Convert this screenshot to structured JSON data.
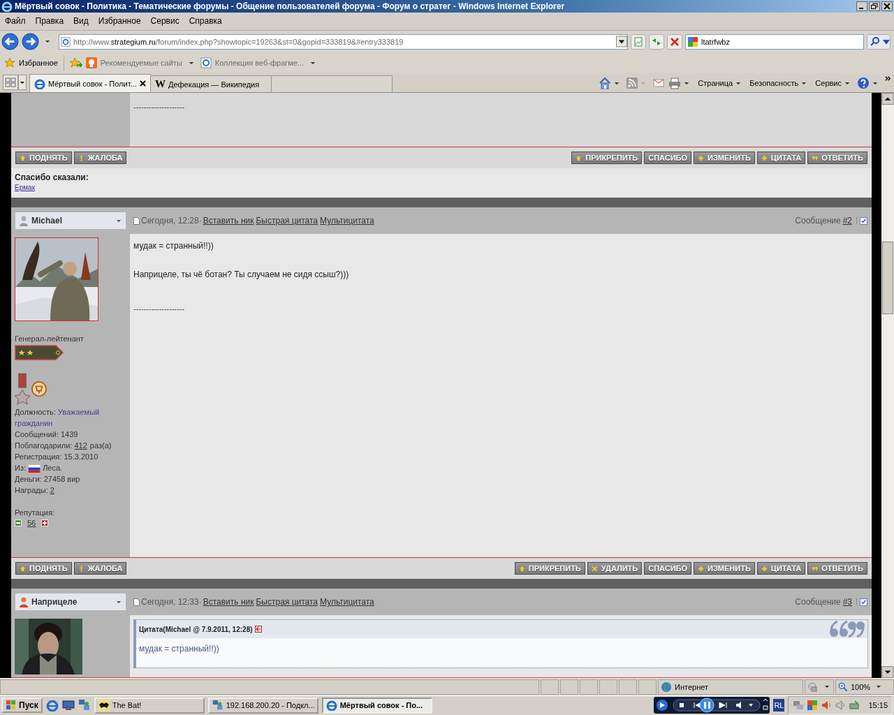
{
  "window": {
    "title": "Мёртвый совок - Политика - Тематические форумы - Общение пользователей форума - Форум о стратег - Windows Internet Explorer"
  },
  "menu": [
    "Файл",
    "Правка",
    "Вид",
    "Избранное",
    "Сервис",
    "Справка"
  ],
  "address": {
    "prefix": "http://www.",
    "domain": "strategium.ru",
    "path": "/forum/index.php?showtopic=19263&st=0&gopid=333819&#entry333819",
    "search": "ltatrfwbz"
  },
  "favorites": {
    "label": "Избранное",
    "items": [
      "Рекомендуемые сайты",
      "Коллекция веб-фрагме..."
    ]
  },
  "tabs": [
    {
      "label": "Мёртвый совок - Полит...",
      "selected": true,
      "kind": "ie"
    },
    {
      "label": "Дефекация — Википедия",
      "selected": false,
      "kind": "wiki",
      "icon_letter": "W"
    }
  ],
  "command_bar": [
    "Страница",
    "Безопасность",
    "Сервис"
  ],
  "posts": [
    {
      "signature": "--------------------",
      "left_buttons": [
        {
          "label": "ПОДНЯТЬ",
          "kind": "up"
        },
        {
          "label": "ЖАЛОБА",
          "kind": "warn"
        }
      ],
      "right_buttons": [
        {
          "label": "ПРИКРЕПИТЬ",
          "kind": "up"
        },
        {
          "label": "СПАСИБО",
          "kind": "plain"
        },
        {
          "label": "ИЗМЕНИТЬ",
          "kind": "plus"
        },
        {
          "label": "ЦИТАТА",
          "kind": "plus"
        },
        {
          "label": "ОТВЕТИТЬ",
          "kind": "quote"
        }
      ],
      "thanks": {
        "title": "Спасибо сказали:",
        "names": [
          "Ермак"
        ]
      }
    },
    {
      "author": "Michael",
      "online": false,
      "date": "Сегодня, 12:28·",
      "actions": [
        "Вставить ник",
        "Быстрая цитата",
        "Мультицитата"
      ],
      "number_label": "Сообщение",
      "number": "#2",
      "checked": true,
      "profile": {
        "rank": "Генерал-лейтенант",
        "fields": [
          {
            "kind": "role",
            "label": "Должность:",
            "value": "Уважаемый гражданин"
          },
          {
            "kind": "text",
            "label": "Сообщений:",
            "value": "1439"
          },
          {
            "kind": "link",
            "label": "Поблагодарили:",
            "value": "412",
            "suffix": "раз(а)"
          },
          {
            "kind": "text",
            "label": "Регистрация:",
            "value": "15.3.2010"
          },
          {
            "kind": "flag",
            "label": "Из:",
            "value": "Леса."
          },
          {
            "kind": "text",
            "label": "Деньги:",
            "value": "27458 вир"
          },
          {
            "kind": "link",
            "label": "Награды:",
            "value": "2"
          }
        ],
        "reputation_label": "Репутация:",
        "reputation": "56"
      },
      "paragraphs": [
        "мудак = странный!!))",
        "Наприцеле, ты чё ботан? Ты случаем не сидя ссыш?)))"
      ],
      "signature": "--------------------",
      "left_buttons": [
        {
          "label": "ПОДНЯТЬ",
          "kind": "up"
        },
        {
          "label": "ЖАЛОБА",
          "kind": "warn"
        }
      ],
      "right_buttons": [
        {
          "label": "ПРИКРЕПИТЬ",
          "kind": "up"
        },
        {
          "label": "УДАЛИТЬ",
          "kind": "cross"
        },
        {
          "label": "СПАСИБО",
          "kind": "plain"
        },
        {
          "label": "ИЗМЕНИТЬ",
          "kind": "plus"
        },
        {
          "label": "ЦИТАТА",
          "kind": "plus"
        },
        {
          "label": "ОТВЕТИТЬ",
          "kind": "quote"
        }
      ]
    },
    {
      "author": "Наприцеле",
      "online": true,
      "date": "Сегодня, 12:33·",
      "actions": [
        "Вставить ник",
        "Быстрая цитата",
        "Мультицитата"
      ],
      "number_label": "Сообщение",
      "number": "#3",
      "checked": true,
      "quote": {
        "header": "Цитата(Michael @ 7.9.2011, 12:28)",
        "text": "мудак = странный!!))"
      }
    }
  ],
  "status_bar": {
    "zone": "Интернет",
    "zoom": "100%"
  },
  "taskbar": {
    "start": "Пуск",
    "tasks": [
      {
        "label": "The Bat!",
        "selected": false,
        "kind": "bat"
      },
      {
        "label": "192.168.200.20 - Подкл...",
        "selected": false,
        "kind": "net"
      },
      {
        "label": "Мёртвый совок - По...",
        "selected": true,
        "kind": "ie"
      }
    ],
    "lang": "RL",
    "clock": "15:15"
  }
}
